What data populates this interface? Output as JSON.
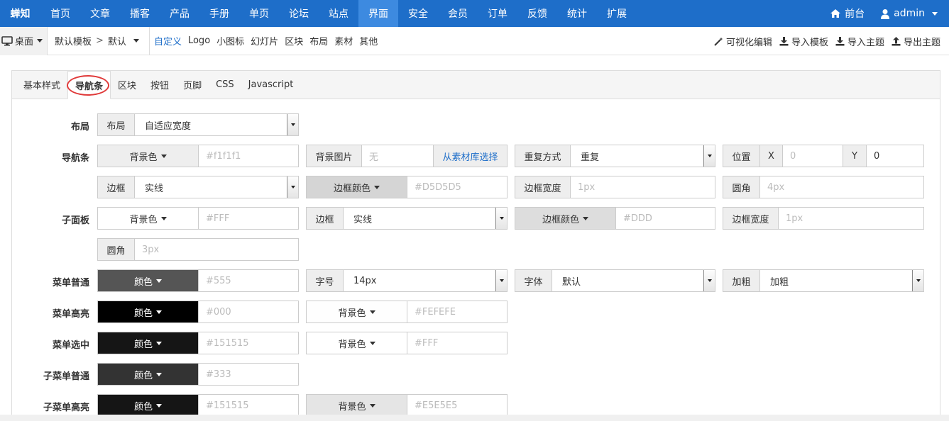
{
  "brand": "蝉知",
  "nav": {
    "items": [
      "首页",
      "文章",
      "播客",
      "产品",
      "手册",
      "单页",
      "论坛",
      "站点",
      "界面",
      "安全",
      "会员",
      "订单",
      "反馈",
      "统计",
      "扩展"
    ],
    "active": "界面",
    "front": "前台",
    "user": "admin"
  },
  "subbar": {
    "desktop": "桌面",
    "crumb1": "默认模板",
    "crumb_sep": ">",
    "crumb2": "默认",
    "links": [
      "自定义",
      "Logo",
      "小图标",
      "幻灯片",
      "区块",
      "布局",
      "素材",
      "其他"
    ],
    "active_link": "自定义",
    "right": [
      "可视化编辑",
      "导入模板",
      "导入主题",
      "导出主题"
    ]
  },
  "tabs": [
    "基本样式",
    "导航条",
    "区块",
    "按钮",
    "页脚",
    "CSS",
    "Javascript"
  ],
  "active_tab": "导航条",
  "labels": {
    "layout": "布局",
    "navbar": "导航条",
    "subpanel": "子面板",
    "menu_normal": "菜单普通",
    "menu_hover": "菜单高亮",
    "menu_active": "菜单选中",
    "submenu_normal": "子菜单普通",
    "submenu_hover": "子菜单高亮"
  },
  "fields": {
    "layout_addon": "布局",
    "layout_value": "自适应宽度",
    "bg_color": "背景色",
    "color": "颜色",
    "nav_bg_value": "#f1f1f1",
    "bg_image": "背景图片",
    "bg_image_value": "无",
    "from_library": "从素材库选择",
    "repeat": "重复方式",
    "repeat_value": "重复",
    "position": "位置",
    "pos_x": "X",
    "pos_x_value": "0",
    "pos_y": "Y",
    "pos_y_value": "0",
    "border": "边框",
    "border_value": "实线",
    "border_color": "边框颜色",
    "nav_border_color_value": "#D5D5D5",
    "border_width": "边框宽度",
    "border_width_value": "1px",
    "radius": "圆角",
    "nav_radius_value": "4px",
    "sub_bg_value": "#FFF",
    "sub_border_color_value": "#DDD",
    "sub_radius_value": "3px",
    "menu_normal_color_value": "#555",
    "font_size": "字号",
    "font_size_value": "14px",
    "font": "字体",
    "font_value": "默认",
    "bold": "加粗",
    "bold_value": "加粗",
    "menu_hover_color_value": "#000",
    "menu_hover_bg_value": "#FEFEFE",
    "menu_active_color_value": "#151515",
    "menu_active_bg_value": "#FFF",
    "submenu_normal_color_value": "#333",
    "submenu_hover_color_value": "#151515",
    "submenu_hover_bg_value": "#E5E5E5"
  },
  "colors": {
    "brand": "#1e6ec9",
    "menu_normal": "#555555",
    "menu_hover": "#000000",
    "menu_active": "#151515",
    "submenu_normal": "#333333",
    "submenu_hover": "#151515",
    "highlight_circle": "#e03a3a"
  }
}
